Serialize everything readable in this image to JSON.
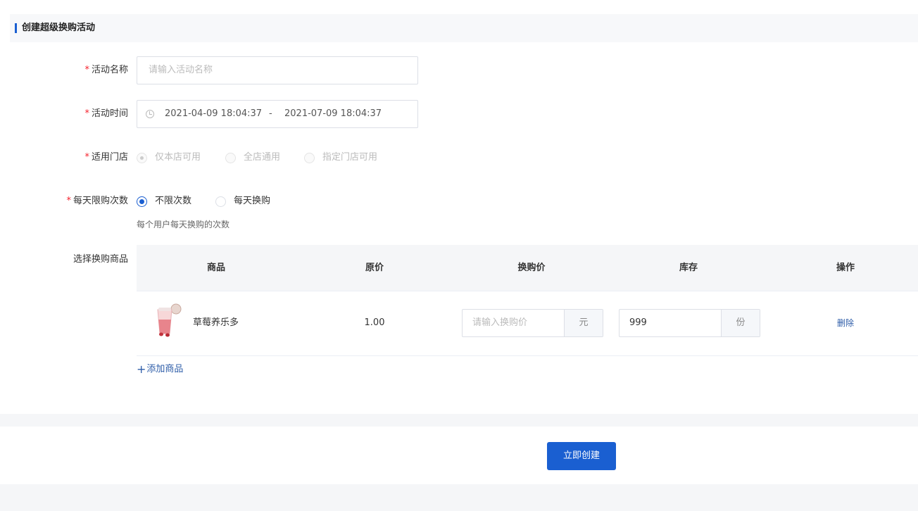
{
  "section": {
    "title": "创建超级换购活动"
  },
  "form": {
    "activity_name": {
      "label": "活动名称",
      "required": "*",
      "placeholder": "请输入活动名称",
      "value": ""
    },
    "activity_time": {
      "label": "活动时间",
      "required": "*",
      "start": "2021-04-09 18:04:37",
      "separator": "-",
      "end": "2021-07-09 18:04:37"
    },
    "store_scope": {
      "label": "适用门店",
      "required": "*",
      "options": [
        {
          "label": "仅本店可用",
          "checked": true,
          "disabled": true
        },
        {
          "label": "全店通用",
          "checked": false,
          "disabled": true
        },
        {
          "label": "指定门店可用",
          "checked": false,
          "disabled": true
        }
      ]
    },
    "daily_limit": {
      "label": "每天限购次数",
      "required": "*",
      "options": [
        {
          "label": "不限次数",
          "checked": true
        },
        {
          "label": "每天换购",
          "checked": false
        }
      ],
      "hint": "每个用户每天换购的次数"
    },
    "products": {
      "label": "选择换购商品",
      "columns": [
        "商品",
        "原价",
        "换购价",
        "库存",
        "操作"
      ],
      "rows": [
        {
          "name": "草莓养乐多",
          "price": "1.00",
          "exchange_price_placeholder": "请输入换购价",
          "exchange_price_unit": "元",
          "stock": "999",
          "stock_unit": "份",
          "action": "删除"
        }
      ],
      "add_label": "添加商品"
    }
  },
  "submit": {
    "label": "立即创建"
  },
  "colors": {
    "primary": "#1a5fd1",
    "required": "#f5222d",
    "link": "#2d5ca8",
    "band": "#f5f6f8"
  },
  "icons": {
    "time": "clock-icon",
    "add": "plus-icon",
    "product": "drink-cup-image"
  }
}
